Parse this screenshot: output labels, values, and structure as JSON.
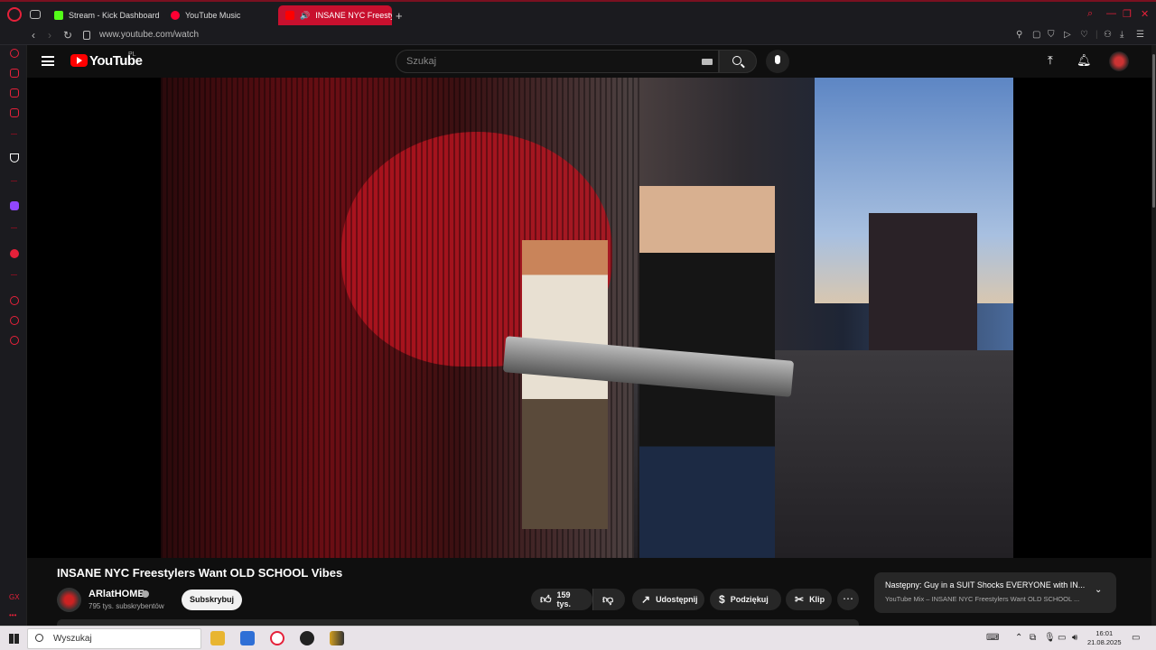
{
  "browser": {
    "tabs": [
      {
        "label": "Stream - Kick Dashboard",
        "icon": "kick-icon",
        "color": "#53fc18"
      },
      {
        "label": "YouTube Music",
        "icon": "youtube-music-icon",
        "color": "#ff0033"
      },
      {
        "label": "INSANE NYC Freestyl",
        "icon": "speaker-icon",
        "color": "#ffffff",
        "active": true
      }
    ],
    "url": "www.youtube.com/watch"
  },
  "youtube": {
    "logo_text": "YouTube",
    "country_code": "PL",
    "search_placeholder": "Szukaj"
  },
  "video": {
    "title": "INSANE NYC Freestylers Want OLD SCHOOL Vibes",
    "channel_name": "ARlatHOME",
    "subscribers": "795 tys. subskrybentów",
    "subscribe_label": "Subskrybuj",
    "likes": "159 tys.",
    "share_label": "Udostępnij",
    "thanks_label": "Podziękuj",
    "clip_label": "Klip",
    "more_label": "⋯"
  },
  "up_next": {
    "title": "Następny: Guy in a SUIT Shocks EVERYONE with IN...",
    "subtitle": "YouTube Mix – INSANE NYC Freestylers Want OLD SCHOOL ..."
  },
  "taskbar": {
    "search_placeholder": "Wyszukaj",
    "time": "16:01",
    "date": "21.08.2025"
  },
  "colors": {
    "opera_red": "#e5213a",
    "active_tab": "#c8102e",
    "youtube_red": "#ff0000",
    "background": "#0f0f0f"
  }
}
